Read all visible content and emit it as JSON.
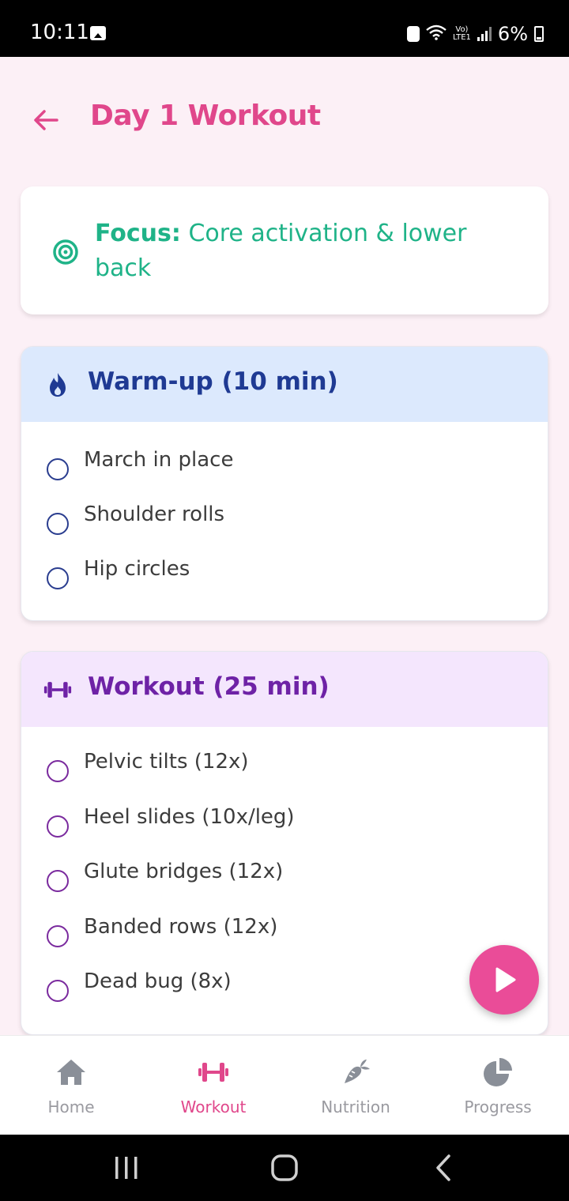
{
  "status_bar": {
    "time": "10:11",
    "battery": "6%",
    "network": "LTE1"
  },
  "header": {
    "title": "Day 1 Workout"
  },
  "focus": {
    "label": "Focus:",
    "text": "Core activation & lower back"
  },
  "warmup": {
    "title": "Warm-up (10 min)",
    "items": [
      "March in place",
      "Shoulder rolls",
      "Hip circles"
    ]
  },
  "workout": {
    "title": "Workout (25 min)",
    "items": [
      "Pelvic tilts (12x)",
      "Heel slides (10x/leg)",
      "Glute bridges (12x)",
      "Banded rows (12x)",
      "Dead bug (8x)"
    ]
  },
  "nav": {
    "items": [
      {
        "label": "Home",
        "icon": "home-icon"
      },
      {
        "label": "Workout",
        "icon": "dumbbell-icon",
        "active": true
      },
      {
        "label": "Nutrition",
        "icon": "carrot-icon"
      },
      {
        "label": "Progress",
        "icon": "pie-chart-icon"
      }
    ]
  },
  "colors": {
    "accent": "#e0478b",
    "focus_green": "#1fb388",
    "warmup_blue": "#1f3a93",
    "workout_purple": "#6e22a6",
    "background": "#fcf0f6"
  }
}
